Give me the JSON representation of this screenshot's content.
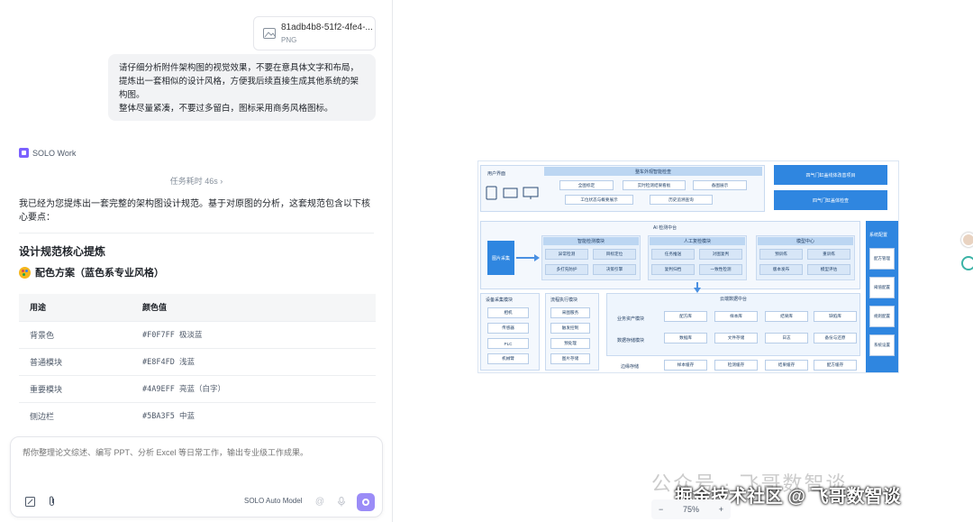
{
  "attachment": {
    "filename": "81adb4b8-51f2-4fe4-...",
    "type": "PNG"
  },
  "user_message": {
    "lines": [
      "请仔细分析附件架构图的视觉效果，不要在意具体文字和布局，提炼出一套相似的设计风格，方便我后续直接生成其他系统的架构图。",
      "整体尽量紧凑，不要过多留白，图标采用商务风格图标。"
    ]
  },
  "agent": {
    "name": "SOLO Work",
    "task_time": "任务耗时 46s ›"
  },
  "reply": {
    "intro": "我已经为您提炼出一套完整的架构图设计规范。基于对原图的分析，这套规范包含以下核心要点：",
    "heading": "设计规范核心提炼",
    "subheading": "配色方案（蓝色系专业风格）"
  },
  "color_table": {
    "headers": [
      "用途",
      "颜色值"
    ],
    "rows": [
      [
        "背景色",
        "#F0F7FF 极淡蓝"
      ],
      [
        "普通模块",
        "#E8F4FD 浅蓝"
      ],
      [
        "重要模块",
        "#4A9EFF 亮蓝（白字）"
      ],
      [
        "侧边栏",
        "#5BA3F5 中蓝"
      ]
    ]
  },
  "composer": {
    "placeholder": "帮你整理论文综述、编写 PPT、分析 Excel 等日常工作，输出专业级工作成果。",
    "model": "SOLO Auto Model"
  },
  "preview": {
    "zoom": "75%",
    "zoom_minus": "−",
    "zoom_plus": "+",
    "watermark_faint": "公众号 · 飞哥数智谈",
    "watermark": "掘金技术社区 @ 飞哥数智谈"
  },
  "diagram": {
    "user_ui": "用户界面",
    "overall_title": "整车外观智能检查",
    "overall_items": [
      "全图标定",
      "实时检测结果看板",
      "备图展示",
      "工位状态与概要展示",
      "历史追溯查询"
    ],
    "right_buttons": [
      "四气门缸盖线体改善项目",
      "四气门缸盖体检查"
    ],
    "ai_center": "AI 检测中台",
    "image_input": "图片采集",
    "smart": {
      "title": "智能检测模块",
      "items": [
        "异常检测",
        "目标定位",
        "多打先防护",
        "决策引擎"
      ]
    },
    "manual": {
      "title": "人工复检模块",
      "items": [
        "任务推送",
        "对图复判",
        "复判归档",
        "一致性检测"
      ]
    },
    "model": {
      "title": "模型中心",
      "items": [
        "预训练",
        "重训练",
        "版本发布",
        "模型评估"
      ]
    },
    "sidebar": {
      "title": "系统配置",
      "items": [
        "配方管理",
        "阈值配置",
        "规则配置",
        "系统设置"
      ]
    },
    "device": {
      "title": "设备采集模块",
      "items": [
        "相机",
        "传感器",
        "PLC",
        "机械臂"
      ]
    },
    "flow": {
      "title": "流程执行模块",
      "items": [
        "采图服务",
        "触发控制",
        "预处理",
        "图片存储"
      ]
    },
    "data_mid": "云端数据中台",
    "biz_row": {
      "label": "业务资产模块",
      "items": [
        "配方库",
        "样本库",
        "结果库",
        "缺陷库"
      ]
    },
    "store_row": {
      "label": "数据存储模块",
      "items": [
        "数据库",
        "文件存储",
        "日志",
        "备份与还原"
      ]
    },
    "edge_row": {
      "label": "边缘存储",
      "items": [
        "样本缓存",
        "检测缓存",
        "结果缓存",
        "配方缓存"
      ]
    }
  }
}
